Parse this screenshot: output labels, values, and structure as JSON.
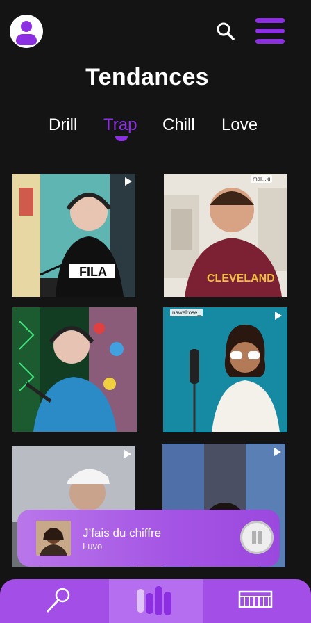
{
  "header": {
    "title": "Tendances"
  },
  "genres": [
    {
      "label": "Drill"
    },
    {
      "label": "Trap"
    },
    {
      "label": "Chill"
    },
    {
      "label": "Love"
    }
  ],
  "selected_genre": "Trap",
  "feed": {
    "tiles": [
      {
        "id": "video-1",
        "overlay_label": ""
      },
      {
        "id": "video-2",
        "overlay_label": "mal...ki"
      },
      {
        "id": "video-3",
        "overlay_label": ""
      },
      {
        "id": "video-4",
        "overlay_label": "nawelrose_"
      },
      {
        "id": "video-5",
        "overlay_label": ""
      },
      {
        "id": "video-6",
        "overlay_label": ""
      }
    ]
  },
  "now_playing": {
    "title": "J’fais du chiffre",
    "artist": "Luvo"
  },
  "colors": {
    "accent": "#8b2fe0",
    "background": "#141414",
    "nav_background": "#a44ee8"
  },
  "icons": {
    "profile": "user-icon",
    "search": "search-icon",
    "menu": "menu-icon",
    "play": "play-icon",
    "pause": "pause-icon",
    "nav_mic": "microphone-icon",
    "nav_trending": "equalizer-bars-icon",
    "nav_beats": "keyboard-icon"
  }
}
